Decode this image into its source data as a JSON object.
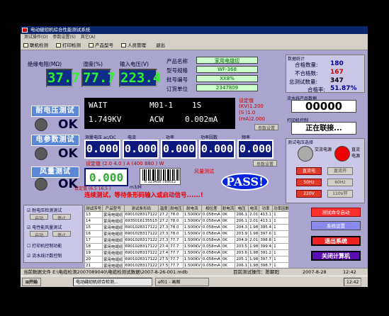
{
  "window": {
    "title": "电动缝纫机综合性能测试系统"
  },
  "menu": [
    "测试操作(O)",
    "参数设置(S)",
    "其它(A)"
  ],
  "toolbar": [
    "联机检测",
    "打印检测",
    "产品型号",
    "人员管理",
    "退出"
  ],
  "top_meters": [
    {
      "label": "绝缘电阻(MΩ)",
      "value": "37.7"
    },
    {
      "label": "湿度(%)",
      "value": "77.7"
    },
    {
      "label": "输入电压(V)",
      "value": "223.4"
    }
  ],
  "product": {
    "name_label": "产品名称",
    "name": "家用电缝纫",
    "model_label": "型号规格",
    "model": "WF-368",
    "batch_label": "批号编号",
    "batch": "XX8%",
    "order_label": "订货单位",
    "order": "2347809"
  },
  "stats": {
    "title": "数据统计",
    "ok_label": "合格数量:",
    "ok": "180",
    "ng_label": "不合格数:",
    "ng": "167",
    "total_label": "总测试数量:",
    "total": "347",
    "rate_label": "合格率:",
    "rate": "51.87%"
  },
  "flow": {
    "label": "流水线产品数据",
    "value": "00000"
  },
  "printer": {
    "label": "打印机控制",
    "value": "正在联接..."
  },
  "hipot": {
    "mode": "WAIT",
    "code": "M01-1",
    "time": "1S",
    "voltage": "1.749KV",
    "type": "ACW",
    "current": "0.002mA",
    "set_label": "设定值",
    "set_kv": "(KV)1.200",
    "set_s": "(S )1.0",
    "set_ma": "(mA)2.000",
    "param_btn": "参数设置"
  },
  "hipot_test": {
    "label": "耐电压测试",
    "result": "OK"
  },
  "elec_test": {
    "label": "电参数测试",
    "result": "OK"
  },
  "fan_test": {
    "label": "风量测试",
    "result": "OK"
  },
  "elec": {
    "headers": [
      "测量电压 ac/DC",
      "电流",
      "功率",
      "功率因数",
      "频率"
    ],
    "values": [
      "0.000",
      "0.000",
      "0.000",
      "0.000",
      "0.000"
    ],
    "set_line": "设定值 (2.0   4.0 ) A (400   880 ) W",
    "set_btn": "参数设置"
  },
  "fan": {
    "value": "0.000",
    "unit": "m3/M",
    "set_line": "设定值 (6.5   16.5 )",
    "status": "风量测试"
  },
  "barcode": {
    "digits": "8 123456 789012"
  },
  "notice": "连续测试，等待条形码输入或启动信号......!",
  "pass": "PASS!",
  "sel": {
    "title": "测试电压选择",
    "ac": "交流电源",
    "dc": "直流电源",
    "btns": [
      "直流电",
      "直流开",
      "50Hz",
      "60Hz",
      "220V",
      "110V开"
    ]
  },
  "left_checks": [
    {
      "label": "耐电压检测测试",
      "b1": "启动",
      "b2": "停止"
    },
    {
      "label": "电性能风量测试",
      "b1": "启动",
      "b2": "停止"
    },
    {
      "label": "打印机控制功能"
    },
    {
      "label": "流水线计数控制"
    }
  ],
  "table": {
    "headers": [
      "测试序号",
      "产品型号",
      "测试条形码",
      "温度",
      "耐电压",
      "耐电流",
      "相位差",
      "耐电流",
      "电压",
      "电流",
      "功率",
      "功率因数",
      "风量"
    ],
    "rows": [
      [
        "13",
        "家用电缝纫",
        "6901028317122",
        "27.2",
        "78.0",
        "1.500KV",
        "0.058mA",
        "0K",
        "206.1",
        "2.01",
        "413.1",
        "1",
        "9.4"
      ],
      [
        "14",
        "家用电缝纫",
        "6935016135515",
        "27.2",
        "78.0",
        "1.500KV",
        "0.058mA",
        "0K",
        "206.1",
        "2.01",
        "413.1",
        "1",
        "10.23"
      ],
      [
        "15",
        "家用电缝纫",
        "6901028317122",
        "27.3",
        "78.0",
        "1.500KV",
        "0.058mA",
        "0K",
        "204.3",
        "1.98",
        "395.4",
        "1",
        "10.23"
      ],
      [
        "16",
        "家用电缝纫",
        "6901028317122",
        "27.3",
        "78.0",
        "1.500KV",
        "0.058mA",
        "0K",
        "203.9",
        "1.98",
        "397.6",
        "1",
        "10.37"
      ],
      [
        "17",
        "家用电缝纫",
        "6901028317122",
        "27.3",
        "77.7",
        "1.500KV",
        "0.058mA",
        "0K",
        "204.9",
        "2.01",
        "398.8",
        "1",
        "10.21"
      ],
      [
        "18",
        "家用电缝纫",
        "6901028317122",
        "27.4",
        "77.7",
        "1.500KV",
        "0.058mA",
        "0K",
        "203.5",
        "1.98",
        "399.4",
        "1",
        "10.25"
      ],
      [
        "19",
        "家用电缝纫",
        "6901028317122",
        "27.4",
        "77.7",
        "1.500KV",
        "0.058mA",
        "0K",
        "203.6",
        "1.98",
        "391.2",
        "1",
        "10.30"
      ],
      [
        "20",
        "家用电缝纫",
        "6901028317122",
        "27.5",
        "77.7",
        "1.500KV",
        "0.058mA",
        "0K",
        "205.1",
        "1.98",
        "397.7",
        "1",
        "9.89"
      ],
      [
        "21",
        "家用电缝纫",
        "6901028317122",
        "27.5",
        "77.7",
        "1.500KV",
        "0.058mA",
        "0K",
        "206.1",
        "1.98",
        "398.7",
        "1",
        "9.89"
      ],
      [
        "22",
        "家用电缝纫",
        "6901028317122",
        "27.6",
        "77.7",
        "1.500KV",
        "0.058mA",
        "0K",
        "206.1",
        "1.98",
        "398.7",
        "1",
        "9.89"
      ]
    ]
  },
  "right_btns": [
    "测试命令启动",
    "系统设置",
    "退出系统",
    "关闭计算机"
  ],
  "statusbar": {
    "file": "当前数据文件 E:\\电缆检测2007089040\\电缆检测试数据\\2007-8-26-001.mdb",
    "operator": "目前测试操作：陈朝阳",
    "date": "2007-8-28",
    "time": "12:42"
  },
  "taskbar": {
    "start": "开始",
    "app": "电动缝纫机综合检测...",
    "paint": "ef01 - 画图",
    "clock": "12:42"
  }
}
